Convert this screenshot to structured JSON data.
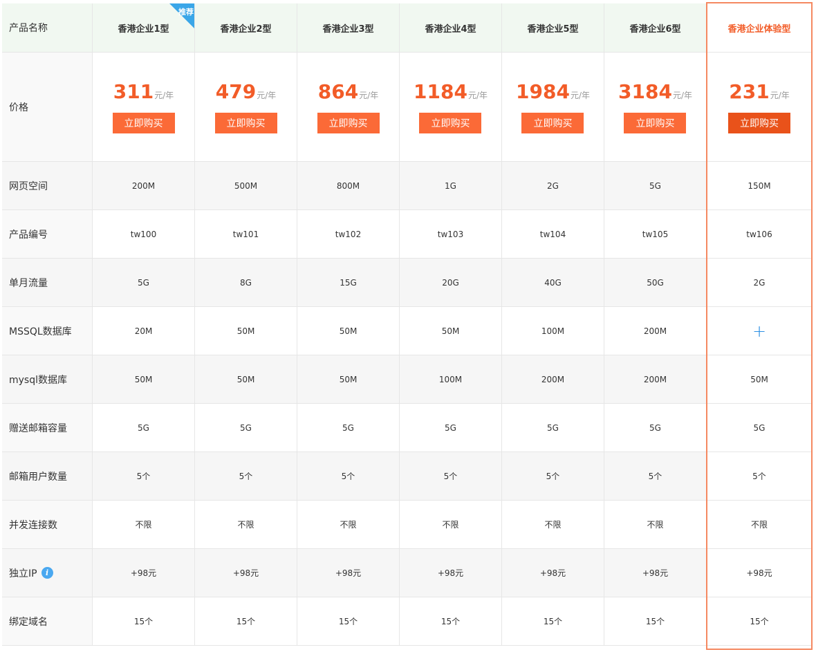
{
  "header": {
    "label": "产品名称",
    "badge": "推荐",
    "plans": [
      "香港企业1型",
      "香港企业2型",
      "香港企业3型",
      "香港企业4型",
      "香港企业5型",
      "香港企业6型"
    ],
    "experience_plan": "香港企业体验型"
  },
  "price": {
    "label": "价格",
    "unit": "元/年",
    "buy_label": "立即购买",
    "amounts": [
      "311",
      "479",
      "864",
      "1184",
      "1984",
      "3184"
    ],
    "experience_amount": "231"
  },
  "rows": [
    {
      "label": "网页空间",
      "values": [
        "200M",
        "500M",
        "800M",
        "1G",
        "2G",
        "5G"
      ],
      "experience": "150M"
    },
    {
      "label": "产品编号",
      "values": [
        "tw100",
        "tw101",
        "tw102",
        "tw103",
        "tw104",
        "tw105"
      ],
      "experience": "tw106"
    },
    {
      "label": "单月流量",
      "values": [
        "5G",
        "8G",
        "15G",
        "20G",
        "40G",
        "50G"
      ],
      "experience": "2G"
    },
    {
      "label": "MSSQL数据库",
      "values": [
        "20M",
        "50M",
        "50M",
        "50M",
        "100M",
        "200M"
      ],
      "experience": "+"
    },
    {
      "label": "mysql数据库",
      "values": [
        "50M",
        "50M",
        "50M",
        "100M",
        "200M",
        "200M"
      ],
      "experience": "50M"
    },
    {
      "label": "赠送邮箱容量",
      "values": [
        "5G",
        "5G",
        "5G",
        "5G",
        "5G",
        "5G"
      ],
      "experience": "5G"
    },
    {
      "label": "邮箱用户数量",
      "values": [
        "5个",
        "5个",
        "5个",
        "5个",
        "5个",
        "5个"
      ],
      "experience": "5个"
    },
    {
      "label": "并发连接数",
      "values": [
        "不限",
        "不限",
        "不限",
        "不限",
        "不限",
        "不限"
      ],
      "experience": "不限"
    },
    {
      "label": "独立IP",
      "values": [
        "+98元",
        "+98元",
        "+98元",
        "+98元",
        "+98元",
        "+98元"
      ],
      "experience": "+98元",
      "info_icon": "i"
    },
    {
      "label": "绑定域名",
      "values": [
        "15个",
        "15个",
        "15个",
        "15个",
        "15个",
        "15个"
      ],
      "experience": "15个"
    }
  ],
  "colors": {
    "accent": "#f25c28",
    "button": "#fb6a37",
    "experience_border": "#f58860",
    "badge": "#3aa6e8",
    "info_icon": "#4aa8f0",
    "plus_icon": "#2b8fe3"
  },
  "icons": {
    "info": "info-icon",
    "plus": "plus-icon",
    "badge": "recommend-badge"
  }
}
